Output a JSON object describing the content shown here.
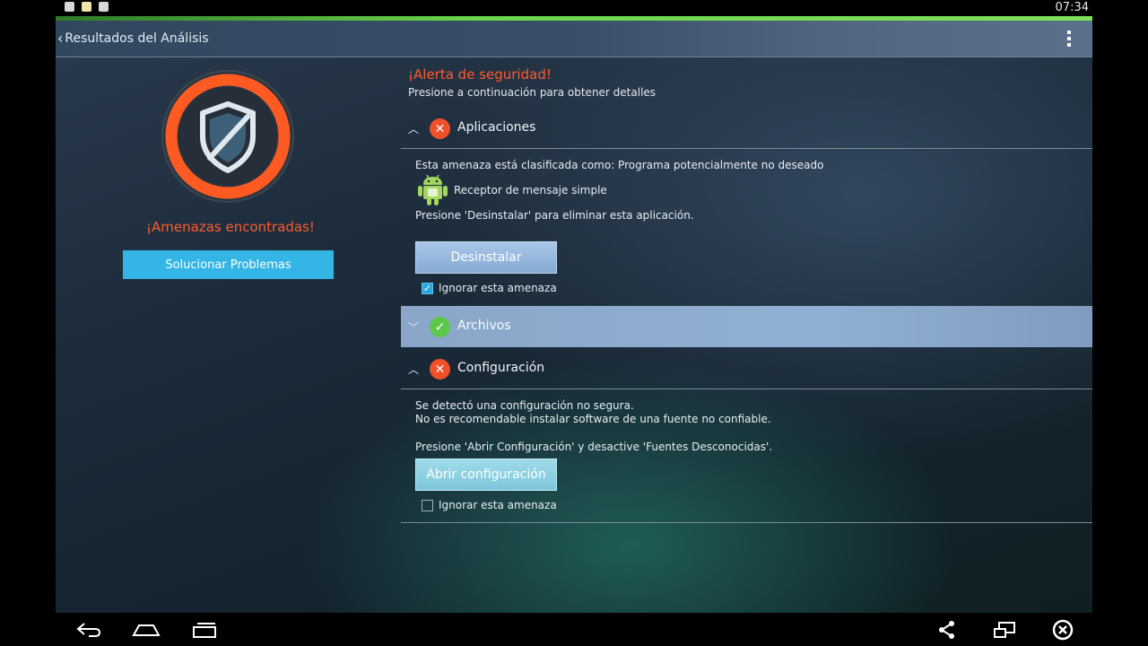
{
  "status_bar": {
    "time": "07:34",
    "notification_icons": [
      "usb-debug-icon",
      "sd-card-icon",
      "shopping-bag-icon"
    ]
  },
  "action_bar": {
    "back_label": "Resultados del Análisis",
    "menu_icon": "overflow-menu-icon"
  },
  "summary": {
    "threats_title": "¡Amenazas encontradas!",
    "fix_button": "Solucionar Problemas",
    "logo_icon": "shield-slash-icon"
  },
  "alert": {
    "title": "¡Alerta de seguridad!",
    "subtitle": "Presione a continuación para obtener detalles"
  },
  "sections": {
    "apps": {
      "label": "Aplicaciones",
      "status": "threat",
      "expanded": true,
      "classification": "Esta amenaza está clasificada como: Programa potencialmente no deseado",
      "app_name": "Receptor de mensaje simple",
      "instruction": "Presione 'Desinstalar' para eliminar esta aplicación.",
      "button": "Desinstalar",
      "ignore_label": "Ignorar esta amenaza",
      "ignore_checked": true
    },
    "files": {
      "label": "Archivos",
      "status": "ok",
      "expanded": false
    },
    "config": {
      "label": "Configuración",
      "status": "threat",
      "expanded": true,
      "line1": "Se detectó una configuración no segura.",
      "line2": "No es recomendable instalar software de una fuente no confiable.",
      "instruction": "Presione 'Abrir Configuración' y desactive 'Fuentes Desconocidas'.",
      "button": "Abrir configuración",
      "ignore_label": "Ignorar esta amenaza",
      "ignore_checked": false
    }
  },
  "nav_bar": [
    "back-icon",
    "home-icon",
    "recents-icon",
    "share-icon",
    "window-icon",
    "close-icon"
  ],
  "colors": {
    "alert": "#ff5a2a",
    "accent_blue": "#33b5e5",
    "status_green": "#5cc84a",
    "status_red": "#f0502a"
  }
}
